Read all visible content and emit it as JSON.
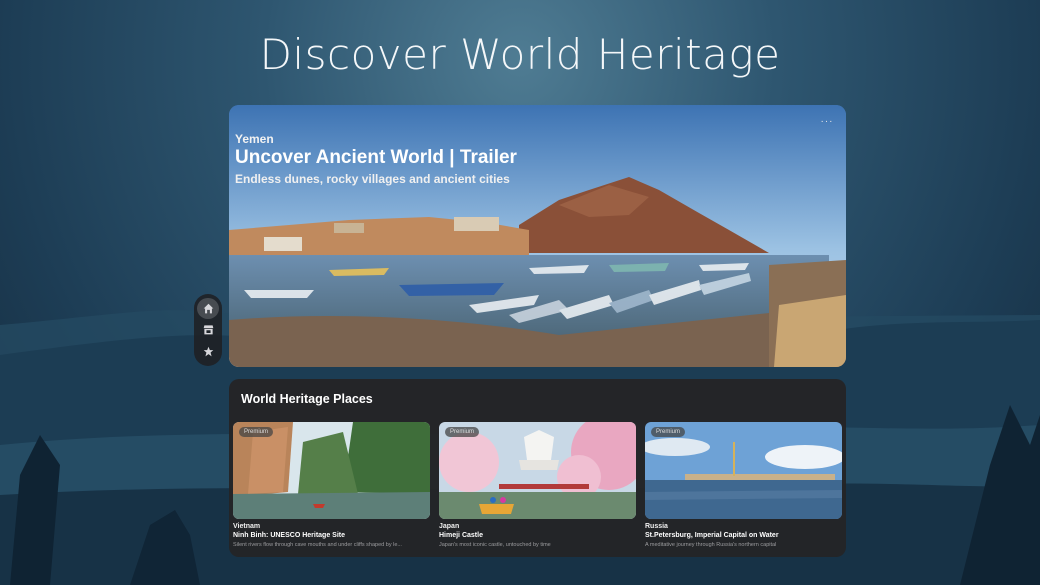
{
  "page": {
    "title": "Discover World Heritage"
  },
  "nav": {
    "items": [
      {
        "name": "home",
        "active": true
      },
      {
        "name": "store",
        "active": false
      },
      {
        "name": "favorites",
        "active": false
      }
    ]
  },
  "hero": {
    "country": "Yemen",
    "title": "Uncover Ancient World | Trailer",
    "subtitle": "Endless dunes, rocky villages and ancient cities",
    "more_label": "···"
  },
  "places": {
    "title": "World Heritage Places",
    "items": [
      {
        "badge": "Premium",
        "country": "Vietnam",
        "name": "Ninh Binh: UNESCO Heritage Site",
        "description": "Silent rivers flow through cave mouths and under cliffs shaped by le..."
      },
      {
        "badge": "Premium",
        "country": "Japan",
        "name": "Himeji Castle",
        "description": "Japan's most iconic castle, untouched by time"
      },
      {
        "badge": "Premium",
        "country": "Russia",
        "name": "St.Petersburg, Imperial Capital on Water",
        "description": "A meditative journey through Russia's northern capital"
      }
    ]
  }
}
